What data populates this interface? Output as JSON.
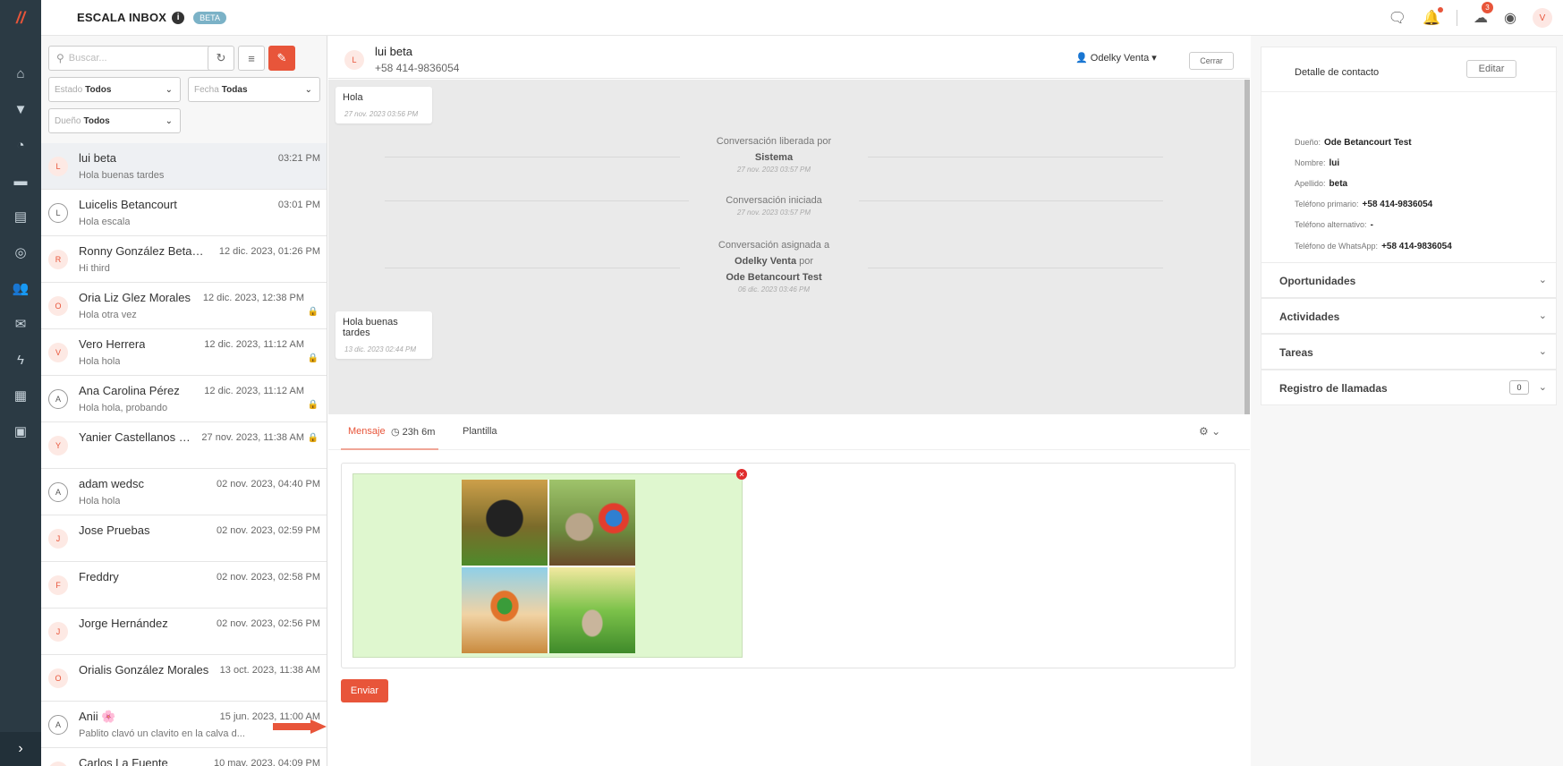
{
  "app": {
    "title": "ESCALA INBOX",
    "beta": "BETA",
    "info": "i",
    "alerts_count": "3",
    "user_initial": "V"
  },
  "filters": {
    "search_placeholder": "Buscar...",
    "estado_label": "Estado",
    "estado_value": "Todos",
    "fecha_label": "Fecha",
    "fecha_value": "Todas",
    "dueno_label": "Dueño",
    "dueno_value": "Todos"
  },
  "conversations": [
    {
      "initial": "L",
      "name": "lui beta",
      "time": "03:21 PM",
      "message": "Hola buenas tardes"
    },
    {
      "initial": "L",
      "name": "Luicelis Betancourt",
      "time": "03:01 PM",
      "message": "Hola escala"
    },
    {
      "initial": "R",
      "name": "Ronny González Betanc...",
      "time": "12 dic. 2023, 01:26 PM",
      "message": "Hi third"
    },
    {
      "initial": "O",
      "name": "Oria Liz Glez Morales",
      "time": "12 dic. 2023, 12:38 PM",
      "message": "Hola otra vez"
    },
    {
      "initial": "V",
      "name": "Vero Herrera",
      "time": "12 dic. 2023, 11:12 AM",
      "message": "Hola hola"
    },
    {
      "initial": "A",
      "name": "Ana Carolina Pérez",
      "time": "12 dic. 2023, 11:12 AM",
      "message": "Hola hola, probando"
    },
    {
      "initial": "Y",
      "name": "Yanier Castellanos G...",
      "time": "27 nov. 2023, 11:38 AM",
      "message": ""
    },
    {
      "initial": "A",
      "name": "adam wedsc",
      "time": "02 nov. 2023, 04:40 PM",
      "message": "Hola hola"
    },
    {
      "initial": "J",
      "name": "Jose Pruebas",
      "time": "02 nov. 2023, 02:59 PM",
      "message": ""
    },
    {
      "initial": "F",
      "name": "Freddry",
      "time": "02 nov. 2023, 02:58 PM",
      "message": ""
    },
    {
      "initial": "J",
      "name": "Jorge Hernández",
      "time": "02 nov. 2023, 02:56 PM",
      "message": ""
    },
    {
      "initial": "O",
      "name": "Orialis González Morales",
      "time": "13 oct. 2023, 11:38 AM",
      "message": ""
    },
    {
      "initial": "A",
      "name": "Anii 🌸",
      "time": "15 jun. 2023, 11:00 AM",
      "message": "Pablito clavó un clavito en la calva d..."
    },
    {
      "initial": "C",
      "name": "Carlos La Fuente",
      "time": "10 may. 2023, 04:09 PM",
      "message": ""
    }
  ],
  "chat": {
    "initial": "L",
    "name": "lui beta",
    "phone": "+58 414-9836054",
    "owner": "Odelky Venta",
    "close_label": "Cerrar",
    "messages": {
      "m1_text": "Hola",
      "m1_date": "27 nov. 2023 03:56 PM",
      "s1_line1": "Conversación liberada por",
      "s1_bold": "Sistema",
      "s1_date": "27 nov. 2023 03:57 PM",
      "s2_line1": "Conversación iniciada",
      "s2_date": "27 nov. 2023 03:57 PM",
      "s3_line1": "Conversación asignada a",
      "s3_bold1": "Odelky Venta",
      "s3_por": "por",
      "s3_bold2": "Ode Betancourt Test",
      "s3_date": "06 dic. 2023 03:46 PM",
      "m2_text": "Hola buenas tardes",
      "m2_date": "13 dic. 2023 02:44 PM"
    }
  },
  "composer": {
    "tab_message": "Mensaje",
    "timer": "23h 6m",
    "tab_template": "Plantilla",
    "send_label": "Enviar"
  },
  "contact": {
    "title": "Detalle de contacto",
    "edit_label": "Editar",
    "owner_label": "Dueño:",
    "owner_value": "Ode Betancourt Test",
    "name_label": "Nombre:",
    "name_value": "lui",
    "lastname_label": "Apellido:",
    "lastname_value": "beta",
    "phone_label": "Teléfono primario:",
    "phone_value": "+58 414-9836054",
    "alt_label": "Teléfono alternativo:",
    "alt_value": "-",
    "wa_label": "Teléfono de WhatsApp:",
    "wa_value": "+58 414-9836054"
  },
  "sections": {
    "opportunities": "Oportunidades",
    "activities": "Actividades",
    "tasks": "Tareas",
    "calls": "Registro de llamadas",
    "calls_count": "0"
  }
}
